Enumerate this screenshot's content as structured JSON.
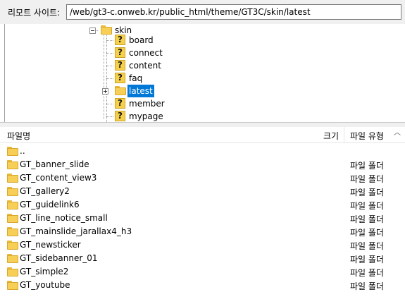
{
  "remote_site": {
    "label": "리모트 사이트:",
    "path": "/web/gt3-c.onweb.kr/public_html/theme/GT3C/skin/latest"
  },
  "tree": {
    "parent": "skin",
    "children": [
      {
        "label": "board",
        "icon": "question-folder-icon"
      },
      {
        "label": "connect",
        "icon": "question-folder-icon"
      },
      {
        "label": "content",
        "icon": "question-folder-icon"
      },
      {
        "label": "faq",
        "icon": "question-folder-icon"
      },
      {
        "label": "latest",
        "icon": "folder-icon",
        "selected": true
      },
      {
        "label": "member",
        "icon": "question-folder-icon"
      },
      {
        "label": "mypage",
        "icon": "question-folder-icon"
      }
    ]
  },
  "file_list": {
    "columns": {
      "name": "파일명",
      "size": "크기",
      "type": "파일 유형"
    },
    "rows": [
      {
        "name": "..",
        "type": ""
      },
      {
        "name": "GT_banner_slide",
        "type": "파일 폴더"
      },
      {
        "name": "GT_content_view3",
        "type": "파일 폴더"
      },
      {
        "name": "GT_gallery2",
        "type": "파일 폴더"
      },
      {
        "name": "GT_guidelink6",
        "type": "파일 폴더"
      },
      {
        "name": "GT_line_notice_small",
        "type": "파일 폴더"
      },
      {
        "name": "GT_mainslide_jarallax4_h3",
        "type": "파일 폴더"
      },
      {
        "name": "GT_newsticker",
        "type": "파일 폴더"
      },
      {
        "name": "GT_sidebanner_01",
        "type": "파일 폴더"
      },
      {
        "name": "GT_simple2",
        "type": "파일 폴더"
      },
      {
        "name": "GT_youtube",
        "type": "파일 폴더"
      }
    ]
  },
  "colors": {
    "selection": "#0078d7",
    "folder": "#f7cf57"
  }
}
